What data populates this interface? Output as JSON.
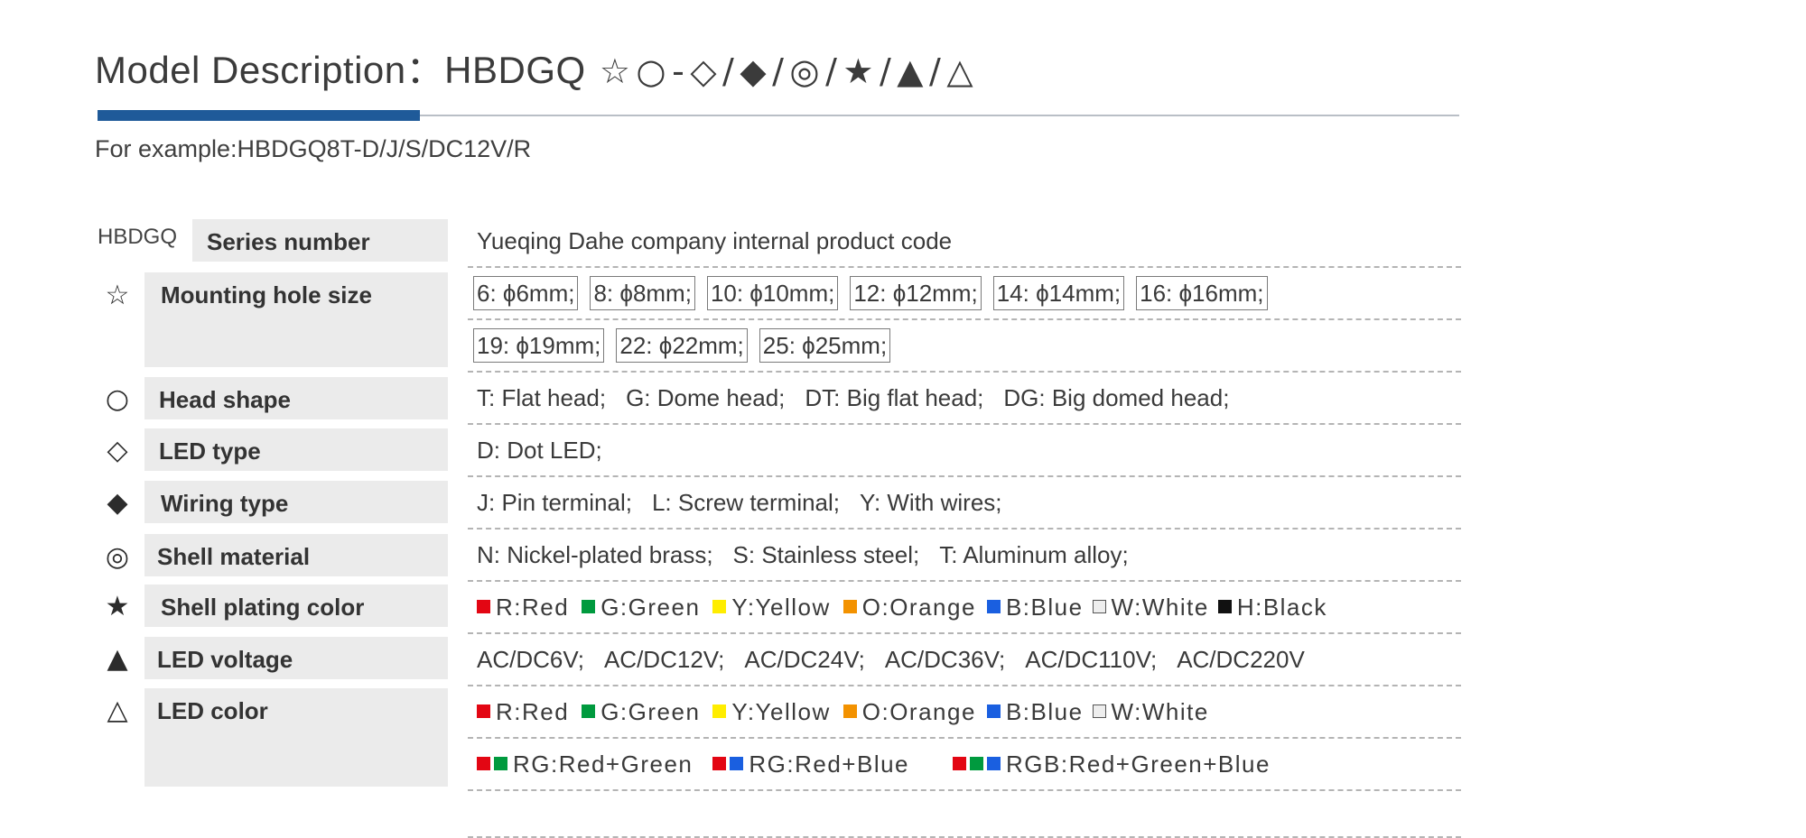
{
  "title": {
    "prefix": "Model Description：HBDGQ",
    "symbols": [
      "☆",
      "○",
      "-",
      "◇",
      "/",
      "◆",
      "/",
      "◎",
      "/",
      "★",
      "/",
      "▲",
      "/",
      "△"
    ]
  },
  "example": "For example:HBDGQ8T-D/J/S/DC12V/R",
  "series": {
    "code": "HBDGQ",
    "label": "Series number",
    "description": "Yueqing Dahe company internal product code"
  },
  "rows": [
    {
      "icon": "☆",
      "icon_name": "star-outline-icon",
      "label": "Mounting hole size"
    },
    {
      "icon": "○",
      "icon_name": "circle-outline-icon",
      "label": "Head  shape"
    },
    {
      "icon": "◇",
      "icon_name": "diamond-outline-icon",
      "label": "LED type"
    },
    {
      "icon": "◆",
      "icon_name": "diamond-filled-icon",
      "label": "Wiring type"
    },
    {
      "icon": "◎",
      "icon_name": "double-circle-icon",
      "label": "Shell material"
    },
    {
      "icon": "★",
      "icon_name": "star-filled-icon",
      "label": "Shell plating color"
    },
    {
      "icon": "▲",
      "icon_name": "triangle-filled-icon",
      "label": "LED voltage"
    },
    {
      "icon": "△",
      "icon_name": "triangle-outline-icon",
      "label": "LED color"
    }
  ],
  "mounting_sizes_line1": [
    "6: ϕ6mm;",
    "8: ϕ8mm;",
    "10: ϕ10mm;",
    "12: ϕ12mm;",
    "14: ϕ14mm;",
    "16: ϕ16mm;"
  ],
  "mounting_sizes_line2": [
    "19: ϕ19mm;",
    "22: ϕ22mm;",
    "25: ϕ25mm;"
  ],
  "head_shapes": [
    "T: Flat head;",
    "G: Dome head;",
    "DT: Big flat head;",
    "DG: Big domed head;"
  ],
  "led_type": "D: Dot LED;",
  "wiring_types": [
    "J: Pin terminal;",
    "L: Screw terminal;",
    "Y: With wires;"
  ],
  "shell_materials": [
    "N: Nickel-plated brass;",
    "S: Stainless steel;",
    "T: Aluminum alloy;"
  ],
  "plating_colors": [
    {
      "text": "R:Red",
      "swatches": [
        "#e30613"
      ]
    },
    {
      "text": "G:Green",
      "swatches": [
        "#009a3e"
      ]
    },
    {
      "text": "Y:Yellow",
      "swatches": [
        "#ffed00"
      ]
    },
    {
      "text": "O:Orange",
      "swatches": [
        "#f39200"
      ]
    },
    {
      "text": "B:Blue",
      "swatches": [
        "#1a5fe0"
      ]
    },
    {
      "text": "W:White",
      "swatches": [
        "#eeeeee"
      ]
    },
    {
      "text": "H:Black",
      "swatches": [
        "#111111"
      ]
    }
  ],
  "voltages": [
    "AC/DC6V;",
    "AC/DC12V;",
    "AC/DC24V;",
    "AC/DC36V;",
    "AC/DC110V;",
    "AC/DC220V"
  ],
  "led_colors_line1": [
    {
      "text": "R:Red",
      "swatches": [
        "#e30613"
      ]
    },
    {
      "text": "G:Green",
      "swatches": [
        "#009a3e"
      ]
    },
    {
      "text": "Y:Yellow",
      "swatches": [
        "#ffed00"
      ]
    },
    {
      "text": "O:Orange",
      "swatches": [
        "#f39200"
      ]
    },
    {
      "text": "B:Blue",
      "swatches": [
        "#1a5fe0"
      ]
    },
    {
      "text": "W:White",
      "swatches": [
        "#eeeeee"
      ]
    }
  ],
  "led_colors_line2": [
    {
      "text": "RG:Red+Green",
      "swatches": [
        "#e30613",
        "#009a3e"
      ]
    },
    {
      "text": "RG:Red+Blue",
      "swatches": [
        "#e30613",
        "#1a5fe0"
      ]
    },
    {
      "text": "RGB:Red+Green+Blue",
      "swatches": [
        "#e30613",
        "#009a3e",
        "#1a5fe0"
      ]
    }
  ],
  "colors": {
    "accent": "#1f5a99",
    "label_bg": "#ebebeb"
  }
}
